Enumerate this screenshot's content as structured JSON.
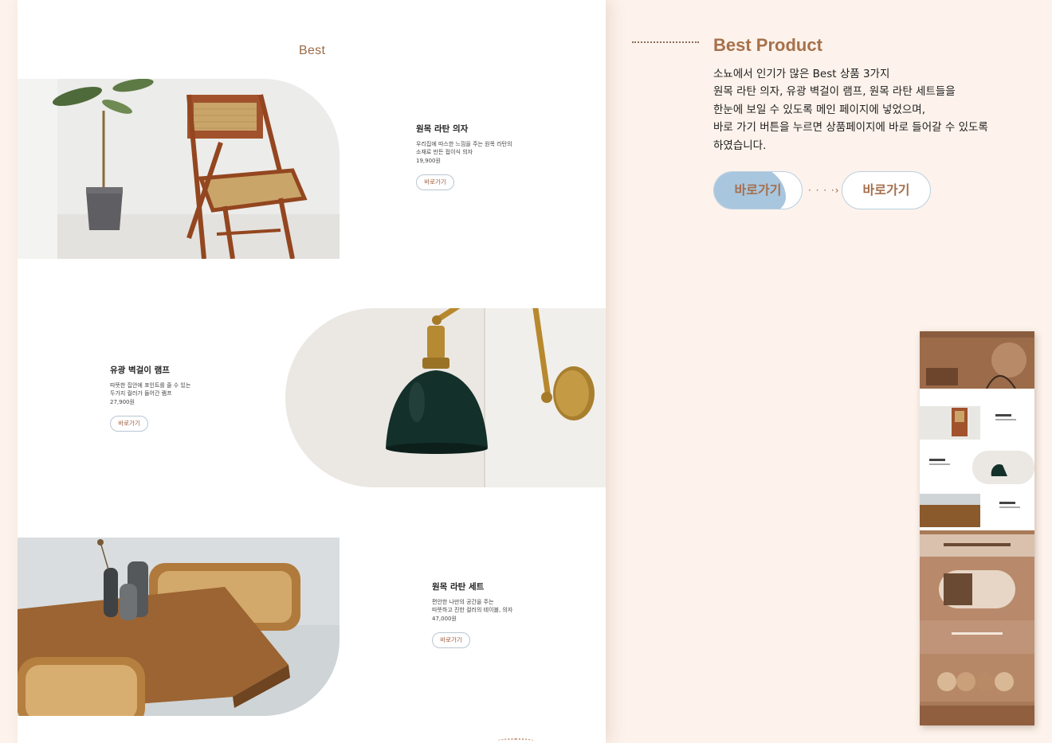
{
  "page": {
    "best_label": "Best",
    "products": [
      {
        "name": "원목 라탄 의자",
        "desc": "우리집에 따스한 느낌을 주는 원목 라탄의\n소재로 만든 접이식 의자",
        "price": "19,900원",
        "button": "바로가기"
      },
      {
        "name": "유광 벽걸이 램프",
        "desc": "따뜻한 집안에 포인트를 줄 수 있는\n두가지 컬러가 들어간 램프",
        "price": "27,900원",
        "button": "바로가기"
      },
      {
        "name": "원목 라탄 세트",
        "desc": "편안한 나만의 공간을 주는\n따뜻하고 진한 컬러의 테이블, 의자",
        "price": "47,000원",
        "button": "바로가기"
      }
    ]
  },
  "explanation": {
    "title": "Best Product",
    "text": "소뇨에서 인기가 많은 Best 상품 3가지\n원목 라탄 의자, 유광 벽걸이 램프, 원목 라탄 세트들을\n한눈에 보일 수 있도록 메인 페이지에 넣었으며,\n바로 가기 버튼을 누르면 상품페이지에 바로 들어갈 수 있도록\n하였습니다.",
    "button_before": "바로가기",
    "button_after": "바로가기",
    "arrow": "· · · ·›"
  },
  "colors": {
    "background": "#fdf3ec",
    "accent_brown": "#a6714b",
    "button_hover_blue": "#a8c6de",
    "button_border": "#b9cfe0"
  },
  "icons": {
    "transition_arrow": "dotted-arrow-icon"
  }
}
